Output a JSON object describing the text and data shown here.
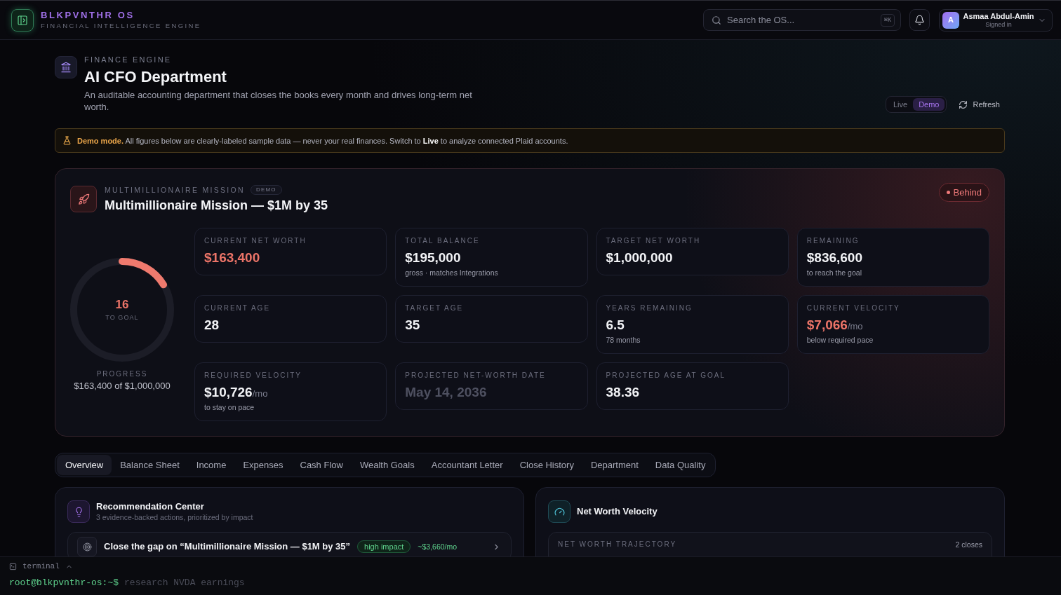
{
  "header": {
    "brand": "BLKPVNTHR OS",
    "tagline": "FINANCIAL INTELLIGENCE ENGINE",
    "search": {
      "placeholder": "Search the OS...",
      "shortcut": "⌘K"
    },
    "user": {
      "initial": "A",
      "name": "Asmaa Abdul-Amin",
      "status": "Signed in"
    }
  },
  "page": {
    "eyebrow": "FINANCE ENGINE",
    "title": "AI CFO Department",
    "description": "An auditable accounting department that closes the books every month and drives long-term net worth.",
    "mode_toggle": [
      {
        "label": "Live",
        "selected": false
      },
      {
        "label": "Demo",
        "selected": true
      }
    ],
    "refresh": "Refresh"
  },
  "banner": {
    "text": "**Demo mode.** All figures below are clearly-labeled sample data — never your real finances. Switch to **Live** to analyze connected Plaid accounts."
  },
  "mission": {
    "eyebrow": "MULTIMILLIONAIRE MISSION",
    "tag": "DEMO",
    "title": "Multimillionaire Mission — $1M by 35",
    "status": {
      "kind": "behind",
      "label": "Behind"
    },
    "progress": {
      "level": 0.1634,
      "value": "16",
      "caption": "TO GOAL",
      "label": "PROGRESS",
      "detail": "$163,400 of $1,000,000"
    },
    "stats": [
      {
        "kind": "alert",
        "label": "CURRENT NET WORTH",
        "value": "$163,400"
      },
      {
        "kind": "plain",
        "label": "TOTAL BALANCE",
        "value": "$195,000",
        "note": "gross · matches Integrations"
      },
      {
        "kind": "plain",
        "label": "TARGET NET WORTH",
        "value": "$1,000,000"
      },
      {
        "kind": "plain",
        "label": "REMAINING",
        "value": "$836,600",
        "note": "to reach the goal"
      },
      {
        "kind": "plain",
        "label": "CURRENT AGE",
        "value": "28"
      },
      {
        "kind": "plain",
        "label": "TARGET AGE",
        "value": "35"
      },
      {
        "kind": "plain",
        "label": "YEARS REMAINING",
        "value": "6.5",
        "note": "78 months"
      },
      {
        "kind": "alert",
        "label": "CURRENT VELOCITY",
        "value": "$7,066",
        "unit": "/mo",
        "note": "below required pace"
      },
      {
        "kind": "plain",
        "label": "REQUIRED VELOCITY",
        "value": "$10,726",
        "unit": "/mo",
        "note": "to stay on pace"
      },
      {
        "kind": "faint",
        "label": "PROJECTED NET-WORTH DATE",
        "value": "May 14, 2036"
      },
      {
        "kind": "plain",
        "label": "PROJECTED AGE AT GOAL",
        "value": "38.36"
      }
    ]
  },
  "tabs": [
    {
      "label": "Overview",
      "selected": true
    },
    {
      "label": "Balance Sheet",
      "selected": false
    },
    {
      "label": "Income",
      "selected": false
    },
    {
      "label": "Expenses",
      "selected": false
    },
    {
      "label": "Cash Flow",
      "selected": false
    },
    {
      "label": "Wealth Goals",
      "selected": false
    },
    {
      "label": "Accountant Letter",
      "selected": false
    },
    {
      "label": "Close History",
      "selected": false
    },
    {
      "label": "Department",
      "selected": false
    },
    {
      "label": "Data Quality",
      "selected": false
    }
  ],
  "recommendations": {
    "title": "Recommendation Center",
    "subtitle": "3 evidence-backed actions, prioritized by impact",
    "items": [
      {
        "title": "Close the gap on “Multimillionaire Mission — $1M by 35”",
        "impact": "high impact",
        "amount": "~$3,660/mo"
      }
    ]
  },
  "velocity": {
    "title": "Net Worth Velocity",
    "chart_heading": "NET WORTH TRAJECTORY",
    "count": "2 closes"
  },
  "terminal": {
    "title": "terminal",
    "prompt": "root@blkpvnthr-os:~$",
    "placeholder": "research NVDA earnings"
  }
}
